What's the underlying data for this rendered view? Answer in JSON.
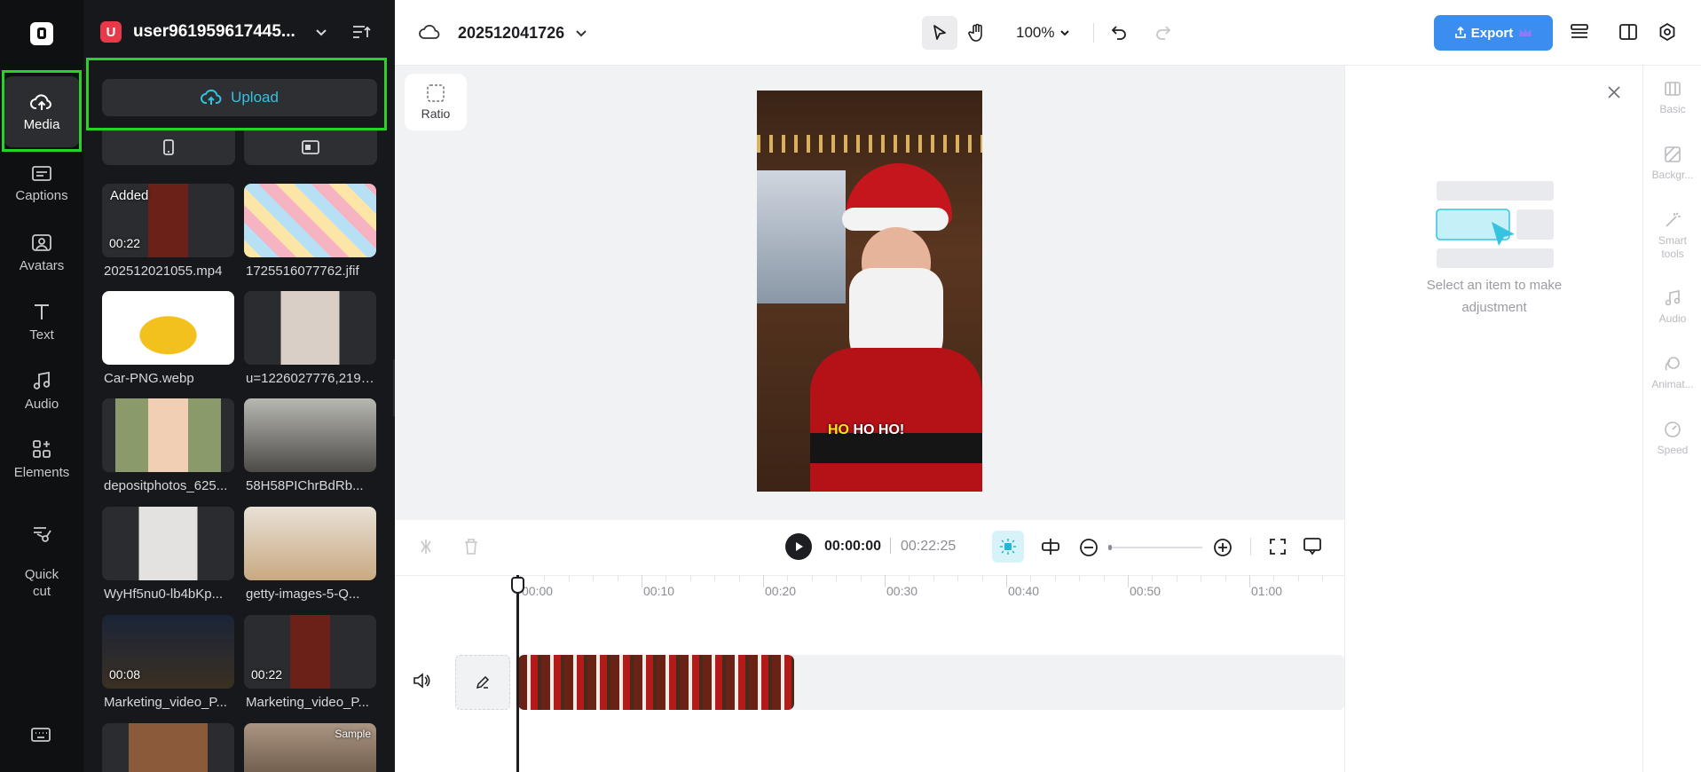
{
  "sidebar": {
    "items": [
      {
        "label": "Media",
        "icon": "cloud-upload-icon"
      },
      {
        "label": "Captions",
        "icon": "captions-icon"
      },
      {
        "label": "Avatars",
        "icon": "avatar-icon"
      },
      {
        "label": "Text",
        "icon": "text-icon"
      },
      {
        "label": "Audio",
        "icon": "music-note-icon"
      },
      {
        "label": "Elements",
        "icon": "elements-icon"
      },
      {
        "label": "Quick\ncut",
        "icon": "scissors-icon"
      }
    ]
  },
  "user": {
    "avatar_letter": "U",
    "name": "user961959617445..."
  },
  "media": {
    "upload_label": "Upload",
    "items": [
      {
        "name": "202512021055.mp4",
        "badge": "Added",
        "duration": "00:22"
      },
      {
        "name": "1725516077762.jfif",
        "badge": "",
        "duration": ""
      },
      {
        "name": "Car-PNG.webp",
        "badge": "",
        "duration": ""
      },
      {
        "name": "u=1226027776,2191...",
        "badge": "",
        "duration": ""
      },
      {
        "name": "depositphotos_625...",
        "badge": "",
        "duration": ""
      },
      {
        "name": "58H58PIChrBdRb...",
        "badge": "",
        "duration": ""
      },
      {
        "name": "WyHf5nu0-lb4bKp...",
        "badge": "",
        "duration": ""
      },
      {
        "name": "getty-images-5-Q...",
        "badge": "",
        "duration": ""
      },
      {
        "name": "Marketing_video_P...",
        "badge": "",
        "duration": "00:08"
      },
      {
        "name": "Marketing_video_P...",
        "badge": "",
        "duration": "00:22"
      },
      {
        "name": "",
        "badge": "",
        "duration": ""
      },
      {
        "name": "",
        "badge": "Sample",
        "duration": ""
      }
    ]
  },
  "project": {
    "title": "202512041726"
  },
  "toolbar": {
    "zoom": "100%",
    "export_label": "Export"
  },
  "canvas": {
    "ratio_label": "Ratio",
    "caption_highlight": "HO",
    "caption_rest": "HO HO!"
  },
  "right_panel": {
    "empty_message": "Select an item to make adjustment"
  },
  "right_rail": {
    "items": [
      {
        "label": "Basic",
        "icon": "basic-icon"
      },
      {
        "label": "Backgr...",
        "icon": "background-icon"
      },
      {
        "label": "Smart tools",
        "icon": "magic-wand-icon"
      },
      {
        "label": "Audio",
        "icon": "music-note-icon"
      },
      {
        "label": "Animat...",
        "icon": "animation-icon"
      },
      {
        "label": "Speed",
        "icon": "speed-icon"
      }
    ]
  },
  "playback": {
    "current_time": "00:00:00",
    "total_time": "00:22:25"
  },
  "timeline": {
    "ticks": [
      "00:00",
      "00:10",
      "00:20",
      "00:30",
      "00:40",
      "00:50",
      "01:00"
    ]
  },
  "colors": {
    "accent": "#1fb8d8",
    "export": "#3b8ef0",
    "highlight": "#2ad12a"
  }
}
